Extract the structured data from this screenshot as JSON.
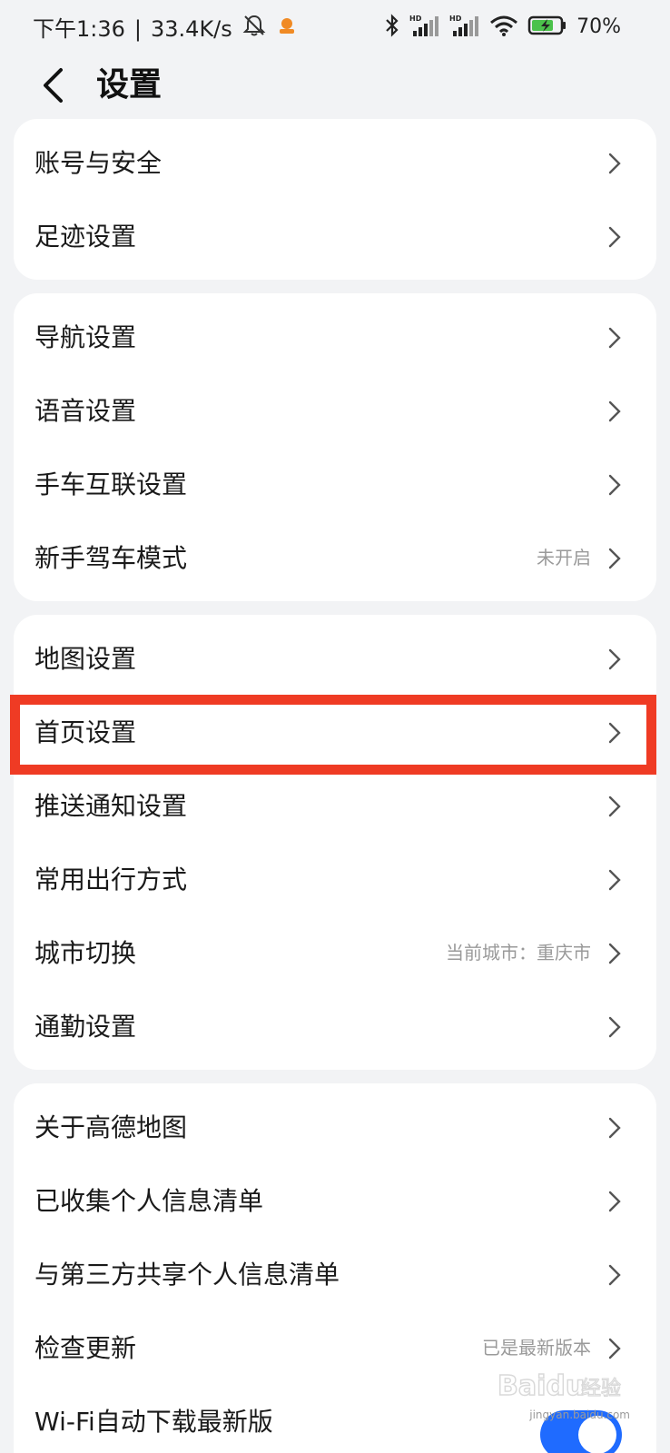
{
  "status_bar": {
    "time": "下午1:36",
    "speed": "33.4K/s",
    "battery": "70%",
    "icons": [
      "bell-off-icon",
      "app-notification-icon",
      "bluetooth-icon",
      "signal-hd-icon",
      "signal-hd-icon",
      "wifi-icon",
      "battery-charging-icon"
    ]
  },
  "header": {
    "title": "设置",
    "back_icon": "chevron-left-icon"
  },
  "groups": [
    {
      "items": [
        {
          "label": "账号与安全",
          "value": ""
        },
        {
          "label": "足迹设置",
          "value": ""
        }
      ]
    },
    {
      "items": [
        {
          "label": "导航设置",
          "value": ""
        },
        {
          "label": "语音设置",
          "value": ""
        },
        {
          "label": "手车互联设置",
          "value": ""
        },
        {
          "label": "新手驾车模式",
          "value": "未开启"
        }
      ]
    },
    {
      "items": [
        {
          "label": "地图设置",
          "value": ""
        },
        {
          "label": "首页设置",
          "value": "",
          "highlighted": true
        },
        {
          "label": "推送通知设置",
          "value": ""
        },
        {
          "label": "常用出行方式",
          "value": ""
        },
        {
          "label": "城市切换",
          "value": "当前城市：重庆市"
        },
        {
          "label": "通勤设置",
          "value": ""
        }
      ]
    },
    {
      "items": [
        {
          "label": "关于高德地图",
          "value": ""
        },
        {
          "label": "已收集个人信息清单",
          "value": ""
        },
        {
          "label": "与第三方共享个人信息清单",
          "value": ""
        },
        {
          "label": "检查更新",
          "value": "已是最新版本"
        },
        {
          "label": "Wi-Fi自动下载最新版",
          "toggle": true,
          "toggle_on": true
        }
      ]
    }
  ],
  "colors": {
    "background": "#f2f3f5",
    "card": "#ffffff",
    "highlight_border": "#ef3b24",
    "toggle_on": "#1f6bff",
    "secondary_text": "#9a9a9a"
  },
  "watermark": {
    "text": "Baidu 经验",
    "sub": "jingyan.baidu.com"
  }
}
